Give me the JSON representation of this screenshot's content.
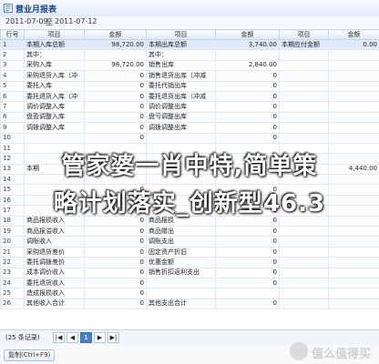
{
  "window": {
    "title": "营业月报表"
  },
  "dates": {
    "start": "2011-07-09",
    "separator": "至",
    "end": "2011-07-12"
  },
  "table": {
    "headers": [
      "行号",
      "项目",
      "金额",
      "项目",
      "金额"
    ],
    "rows": [
      [
        "1",
        "本期入库总额",
        "98,720.00",
        "本期出库总额",
        "3,740.00",
        "本期应付金额",
        "0.00"
      ],
      [
        "2",
        "其中：",
        "",
        "其中：",
        "",
        "",
        ""
      ],
      [
        "3",
        "采购入库",
        "98,720.00",
        "销售出库",
        "2,840.00",
        "",
        ""
      ],
      [
        "4",
        "采购退货入库（冲",
        "0",
        "销售退货出库（冲减",
        "0",
        "",
        ""
      ],
      [
        "5",
        "委托入库",
        "0",
        "委托代销出库",
        "0",
        "",
        ""
      ],
      [
        "6",
        "委托退货入库（冲",
        "0",
        "委托退货出库（冲减",
        "0",
        "",
        ""
      ],
      [
        "7",
        "调价调整入库",
        "0",
        "调价调整出库",
        "0",
        "",
        ""
      ],
      [
        "8",
        "盘盈调整入库",
        "0",
        "盘亏调整出库",
        "0",
        "",
        ""
      ],
      [
        "9",
        "调拨调整入库",
        "0",
        "调拨调整出库",
        "0",
        "",
        ""
      ],
      [
        "10",
        "",
        "0",
        "",
        "0",
        "",
        ""
      ],
      [
        "11",
        "",
        "",
        "",
        "",
        "",
        ""
      ],
      [
        "12",
        "",
        "",
        "",
        "",
        "",
        ""
      ],
      [
        "13",
        "本期",
        "",
        "",
        "",
        "",
        "4,440.00"
      ],
      [
        "14",
        "",
        "",
        "",
        "",
        "",
        ""
      ],
      [
        "15",
        "",
        "0",
        "",
        "0",
        "",
        ""
      ],
      [
        "16",
        "",
        "0",
        "",
        "0",
        "",
        ""
      ],
      [
        "17",
        "",
        "0",
        "",
        "0",
        "",
        ""
      ],
      [
        "18",
        "商品报损收入",
        "0",
        "商品报损",
        "0",
        "",
        ""
      ],
      [
        "19",
        "商品报溢收入",
        "0",
        "商品赠出",
        "0",
        "",
        ""
      ],
      [
        "20",
        "调账收入",
        "0",
        "调账支出",
        "0",
        "",
        ""
      ],
      [
        "21",
        "采购退货差价",
        "0",
        "固定资产折旧",
        "0",
        "",
        ""
      ],
      [
        "22",
        "委托调拨差价",
        "0",
        "优惠金额",
        "0",
        "",
        ""
      ],
      [
        "23",
        "成本调价收入",
        "0",
        "销售折扣返利支出",
        "0",
        "",
        ""
      ],
      [
        "24",
        "委托退货收入",
        "0",
        "",
        "0",
        "",
        ""
      ],
      [
        "25",
        "造成报损收入",
        "0",
        "",
        "",
        "",
        ""
      ],
      [
        "26",
        "其他收入合计",
        "0",
        "其他支出合计",
        "0",
        "",
        ""
      ]
    ]
  },
  "overlay": {
    "line1": "管家婆一肖中特,简单策",
    "line2": "略计划落实_创新型46.3"
  },
  "status": {
    "count": "(25 条记录)",
    "pages": [
      "|◀",
      "◀",
      "1",
      "▶",
      "▶|"
    ]
  },
  "copy_button": "复制(Ctrl+F9)",
  "watermark": "值么值得买",
  "colors": {
    "header_blue": "#15428b",
    "selected_row": "#dfeafa",
    "accent": "#4a7fc1"
  }
}
